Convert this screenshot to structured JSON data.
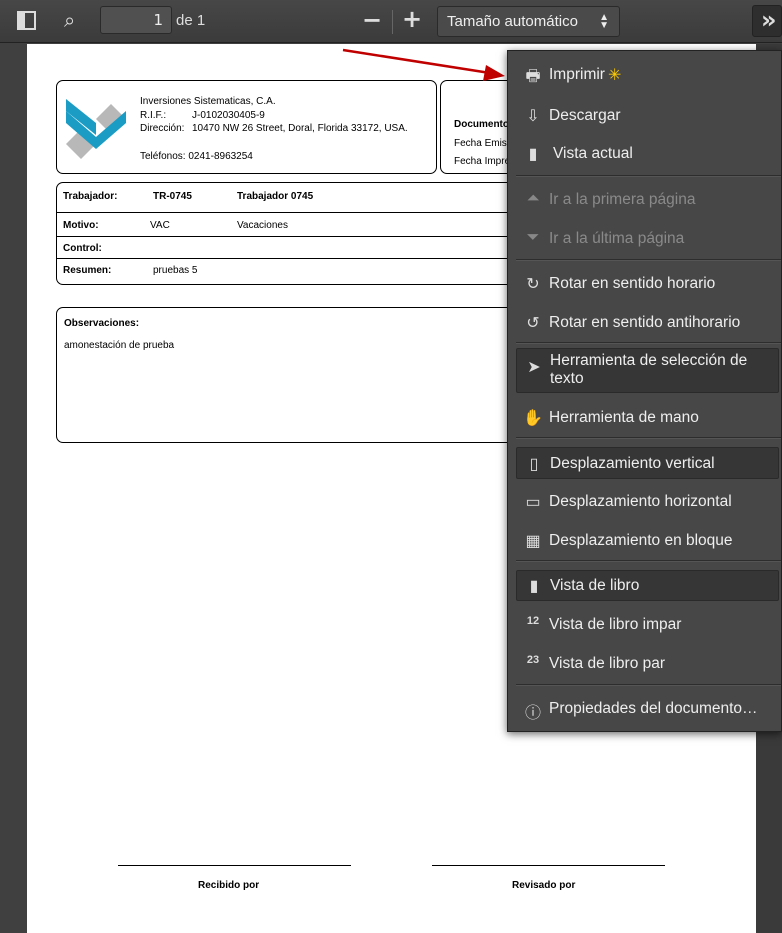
{
  "toolbar": {
    "page_number": "1",
    "page_of": "de 1",
    "zoom_select": "Tamaño automático",
    "zoom_out": "−",
    "zoom_in": "+",
    "more_tools": "»"
  },
  "document": {
    "company": {
      "name": "Inversiones Sistematicas, C.A.",
      "rif_label": "R.I.F.:",
      "rif": "J-0102030405-9",
      "address_label": "Dirección:",
      "address": "10470 NW 26 Street, Doral, Florida 33172, USA.",
      "phones": "Teléfonos: 0241-8963254"
    },
    "doc_info": {
      "document_label": "Documento",
      "issue_label": "Fecha Emisi",
      "print_label": "Fecha Impre"
    },
    "rows": {
      "worker_label": "Trabajador:",
      "worker_code": "TR-0745",
      "worker_name": "Trabajador 0745",
      "reason_label": "Motivo:",
      "reason_code": "VAC",
      "reason_name": "Vacaciones",
      "control_label": "Control:",
      "summary_label": "Resumen:",
      "summary": "pruebas 5"
    },
    "observations": {
      "label": "Observaciones:",
      "text": "amonestación de prueba"
    },
    "signatures": {
      "received": "Recibido por",
      "reviewed": "Revisado por"
    }
  },
  "menu": {
    "items": [
      {
        "label": "Imprimir",
        "icon": "printer-icon"
      },
      {
        "label": "Descargar",
        "icon": "download-icon"
      },
      {
        "label": "Vista actual",
        "icon": "bookmark-icon"
      },
      {
        "label": "Ir a la primera página",
        "icon": "first-page-icon",
        "disabled": true
      },
      {
        "label": "Ir a la última página",
        "icon": "last-page-icon",
        "disabled": true
      },
      {
        "label": "Rotar en sentido horario",
        "icon": "rotate-cw-icon"
      },
      {
        "label": "Rotar en sentido antihorario",
        "icon": "rotate-ccw-icon"
      },
      {
        "label": "Herramienta de selección de texto",
        "icon": "cursor-icon",
        "selected": true
      },
      {
        "label": "Herramienta de mano",
        "icon": "hand-icon"
      },
      {
        "label": "Desplazamiento vertical",
        "icon": "scroll-vertical-icon",
        "selected": true
      },
      {
        "label": "Desplazamiento horizontal",
        "icon": "scroll-horizontal-icon"
      },
      {
        "label": "Desplazamiento en bloque",
        "icon": "scroll-wrapped-icon"
      },
      {
        "label": "Vista de libro",
        "icon": "single-page-icon",
        "selected": true
      },
      {
        "label": "Vista de libro impar",
        "icon": "odd-spread-icon"
      },
      {
        "label": "Vista de libro par",
        "icon": "even-spread-icon"
      },
      {
        "label": "Propiedades del documento…",
        "icon": "info-icon"
      }
    ]
  },
  "colors": {
    "logo_blue": "#1a9cc4",
    "logo_gray": "#b8b8b8",
    "arrow_red": "#c00000"
  }
}
